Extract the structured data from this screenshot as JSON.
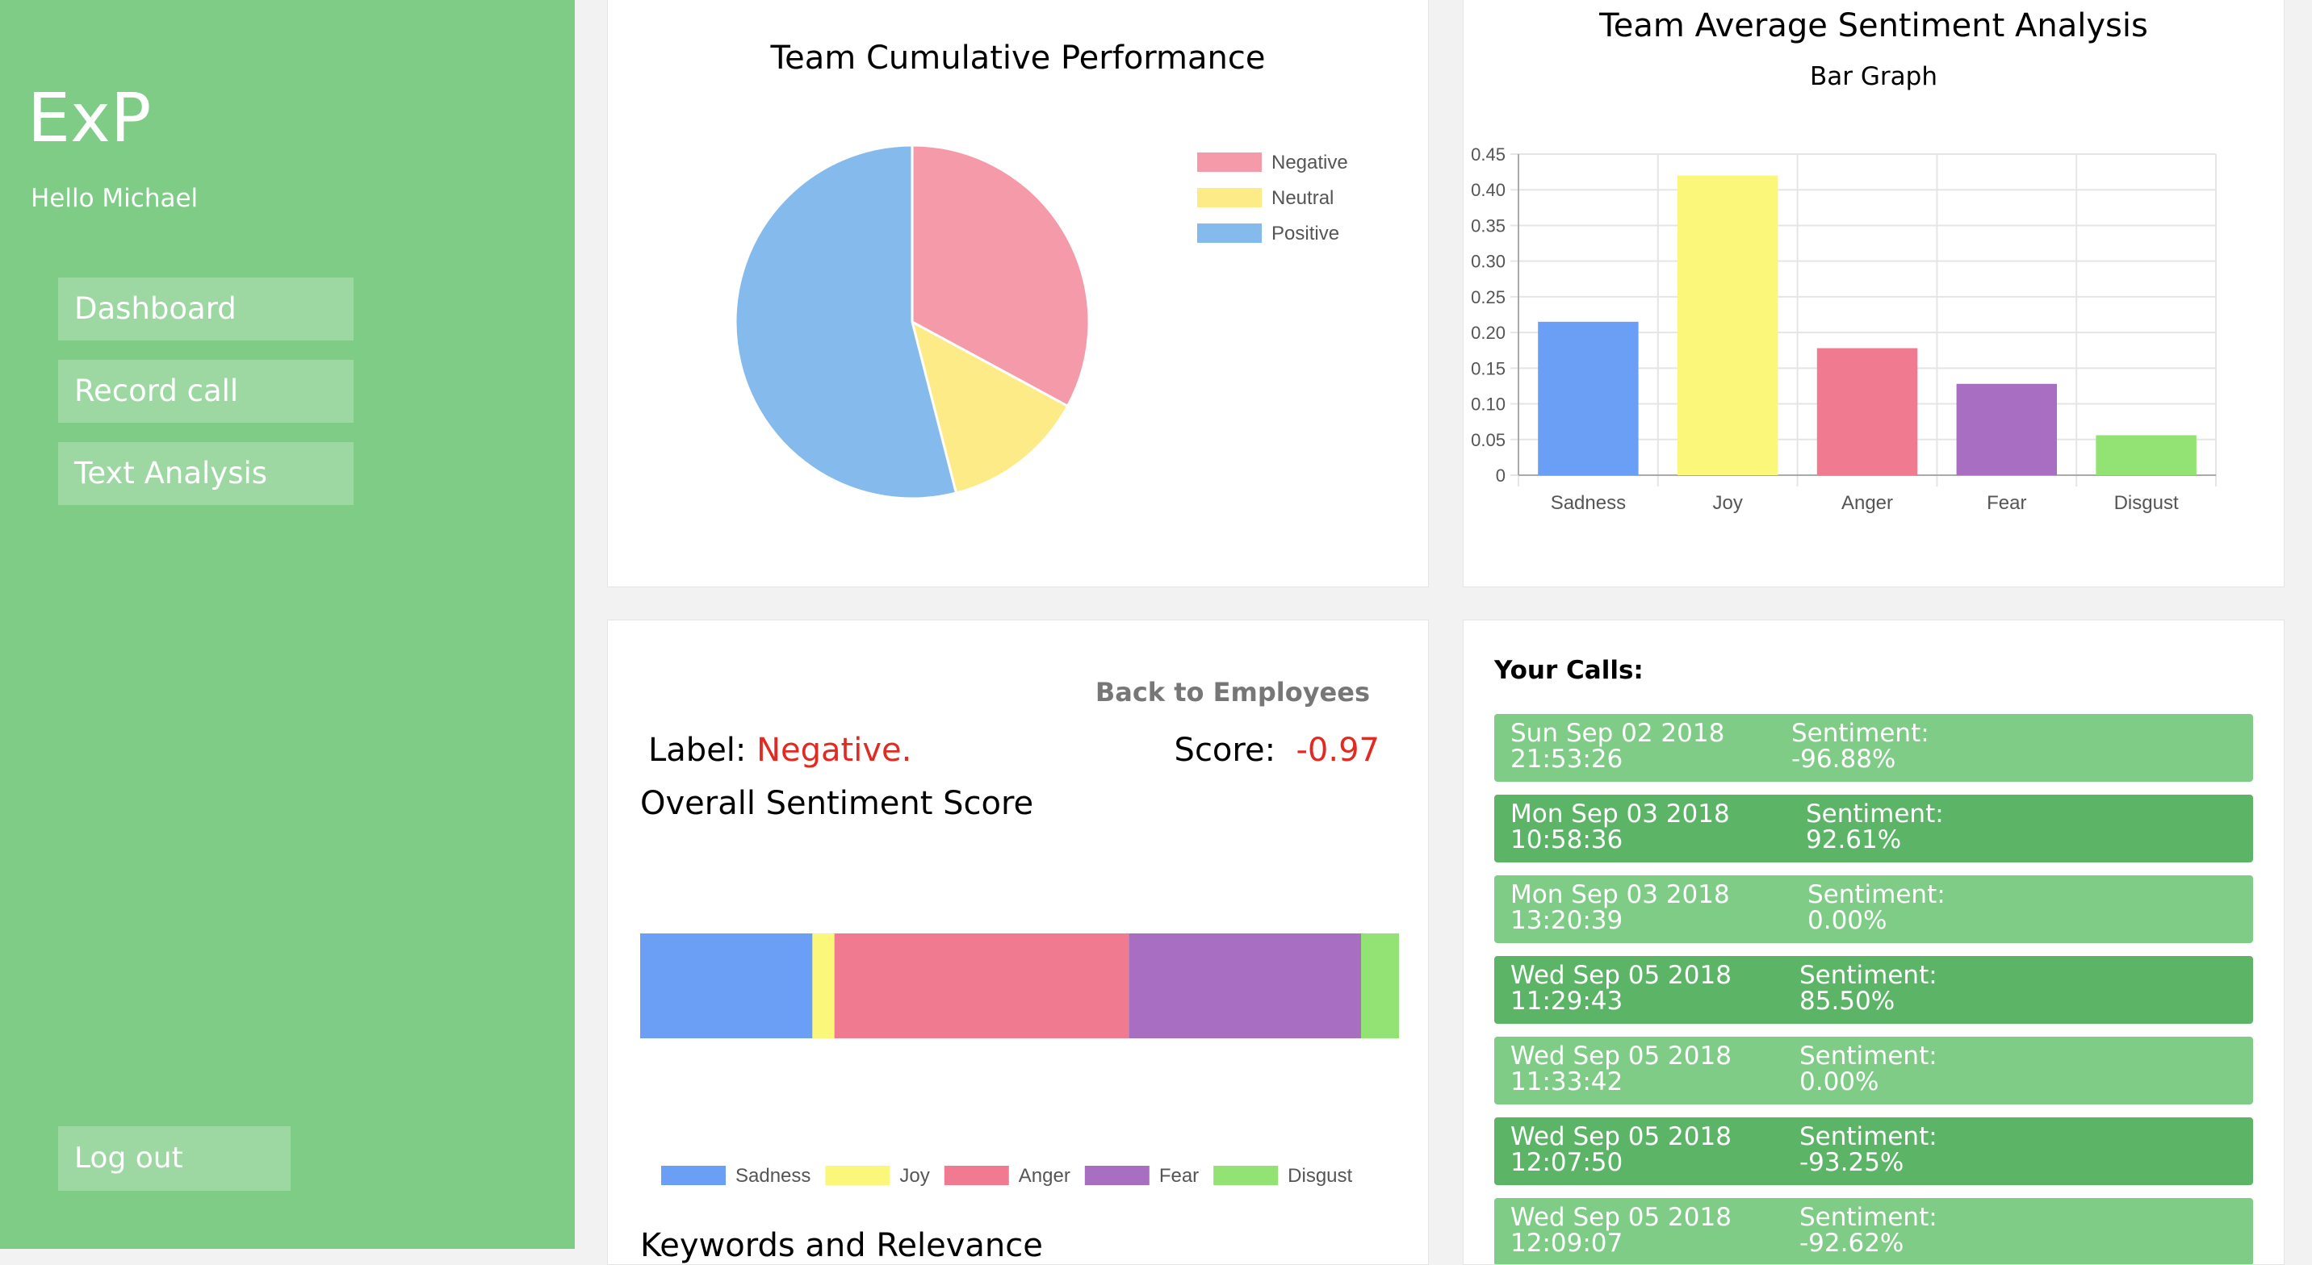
{
  "sidebar": {
    "logo": "ExP",
    "greeting": "Hello Michael",
    "nav": [
      {
        "label": "Dashboard"
      },
      {
        "label": "Record call"
      },
      {
        "label": "Text Analysis"
      }
    ],
    "logout": "Log out",
    "bg_color": "#7fcc87",
    "button_color": "#9dd8a2"
  },
  "pie_card": {
    "title": "Team Cumulative Performance"
  },
  "bar_card": {
    "title": "Team Average Sentiment Analysis",
    "subtitle": "Bar Graph"
  },
  "detail_card": {
    "back_link": "Back to Employees",
    "label_prefix": "Label:",
    "label_value": "Negative.",
    "score_prefix": "Score:",
    "score_value": "-0.97",
    "overall_title": "Overall Sentiment Score",
    "keywords_title": "Keywords and Relevance"
  },
  "calls_card": {
    "title": "Your Calls:",
    "sentiment_label": "Sentiment:",
    "calls": [
      {
        "date": "Sun Sep 02 2018",
        "time": "21:53:26",
        "sentiment": "-96.88%",
        "color": "#7fcc87"
      },
      {
        "date": "Mon Sep 03 2018",
        "time": "10:58:36",
        "sentiment": "92.61%",
        "color": "#5cb567"
      },
      {
        "date": "Mon Sep 03 2018",
        "time": "13:20:39",
        "sentiment": "0.00%",
        "color": "#7fcc87"
      },
      {
        "date": "Wed Sep 05 2018",
        "time": "11:29:43",
        "sentiment": "85.50%",
        "color": "#5cb567"
      },
      {
        "date": "Wed Sep 05 2018",
        "time": "11:33:42",
        "sentiment": "0.00%",
        "color": "#7fcc87"
      },
      {
        "date": "Wed Sep 05 2018",
        "time": "12:07:50",
        "sentiment": "-93.25%",
        "color": "#5cb567"
      },
      {
        "date": "Wed Sep 05 2018",
        "time": "12:09:07",
        "sentiment": "-92.62%",
        "color": "#7fcc87"
      }
    ]
  },
  "chart_data": [
    {
      "type": "pie",
      "title": "Team Cumulative Performance",
      "labels": [
        "Negative",
        "Neutral",
        "Positive"
      ],
      "values": [
        32.9,
        13.1,
        54.0
      ],
      "colors": [
        "#f49aa9",
        "#fceb86",
        "#84bbec"
      ],
      "legend": "top-right"
    },
    {
      "type": "bar",
      "title": "Team Average Sentiment Analysis",
      "subtitle": "Bar Graph",
      "categories": [
        "Sadness",
        "Joy",
        "Anger",
        "Fear",
        "Disgust"
      ],
      "values": [
        0.215,
        0.42,
        0.178,
        0.128,
        0.056
      ],
      "colors": [
        "#6b9ef5",
        "#faf77a",
        "#f07a8f",
        "#a86ec1",
        "#92e374"
      ],
      "ylim": [
        0,
        0.45
      ],
      "yticks": [
        "0",
        "0.05",
        "0.10",
        "0.15",
        "0.20",
        "0.25",
        "0.30",
        "0.35",
        "0.40",
        "0.45"
      ],
      "grid": true
    },
    {
      "type": "bar",
      "stacked": true,
      "orientation": "horizontal",
      "title": "Overall Sentiment Score",
      "series": [
        {
          "name": "Sadness",
          "value": 0.227,
          "color": "#6b9ef5"
        },
        {
          "name": "Joy",
          "value": 0.029,
          "color": "#faf77a"
        },
        {
          "name": "Anger",
          "value": 0.388,
          "color": "#f07a8f"
        },
        {
          "name": "Fear",
          "value": 0.306,
          "color": "#a86ec1"
        },
        {
          "name": "Disgust",
          "value": 0.05,
          "color": "#92e374"
        }
      ],
      "legend": "bottom"
    }
  ]
}
